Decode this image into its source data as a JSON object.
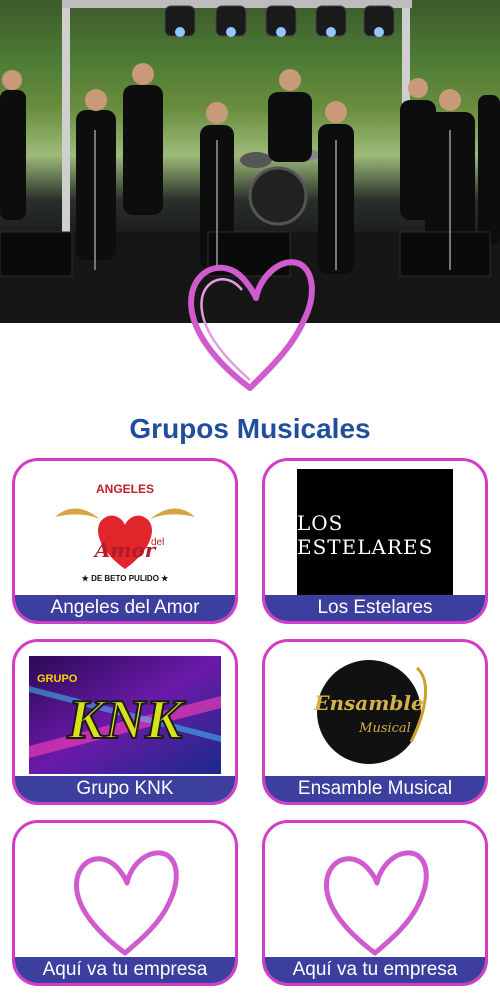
{
  "hero": {
    "alt_icon": "heart-icon"
  },
  "section": {
    "title": "Grupos Musicales"
  },
  "groups": [
    {
      "label": "Angeles del Amor",
      "logo": {
        "top": "ANGELES",
        "main": "Amor",
        "small": "del",
        "bottom": "★ DE BETO PULIDO ★"
      }
    },
    {
      "label": "Los Estelares",
      "logo": {
        "text": "LOS ESTELARES"
      }
    },
    {
      "label": "Grupo KNK",
      "logo": {
        "small": "GRUPO",
        "main": "KNK"
      }
    },
    {
      "label": "Ensamble Musical",
      "logo": {
        "main": "Ensamble",
        "sub": "Musical"
      }
    },
    {
      "label": "Aquí va tu empresa"
    },
    {
      "label": "Aquí va tu empresa"
    }
  ],
  "colors": {
    "title": "#1f4f9c",
    "card_border": "#d23cc6",
    "label_bg": "#3c3f9d",
    "heart": "#d05bcf"
  }
}
